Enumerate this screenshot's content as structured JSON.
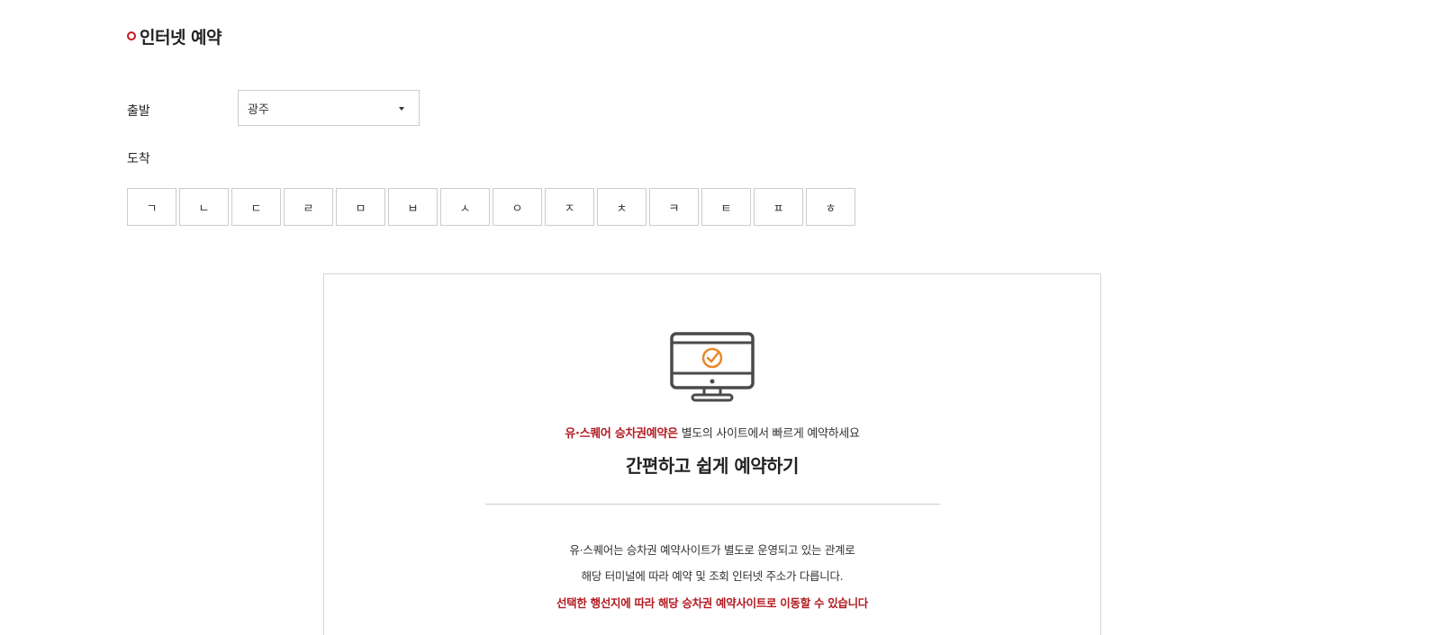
{
  "section": {
    "title": "인터넷 예약"
  },
  "departure": {
    "label": "출발",
    "selected": "광주"
  },
  "arrival": {
    "label": "도착",
    "consonants": [
      "ㄱ",
      "ㄴ",
      "ㄷ",
      "ㄹ",
      "ㅁ",
      "ㅂ",
      "ㅅ",
      "ㅇ",
      "ㅈ",
      "ㅊ",
      "ㅋ",
      "ㅌ",
      "ㅍ",
      "ㅎ"
    ]
  },
  "info": {
    "icon": "monitor-check-icon",
    "tagline_highlight": "유·스퀘어 승차권예약은",
    "tagline_rest": " 별도의 사이트에서 빠르게 예약하세요",
    "headline": "간편하고 쉽게 예약하기",
    "desc_1": "유·스퀘어는 승차권 예약사이트가 별도로 운영되고 있는 관계로",
    "desc_2": "해당 터미널에 따라 예약 및 조회 인터넷 주소가 다릅니다.",
    "desc_3": "선택한 행선지에 따라 해당 승차권 예약사이트로 이동할 수 있습니다"
  },
  "colors": {
    "accent": "#b31b22",
    "icon_stroke": "#4a4a4a",
    "icon_check": "#e8892b",
    "border": "#cccccc"
  }
}
